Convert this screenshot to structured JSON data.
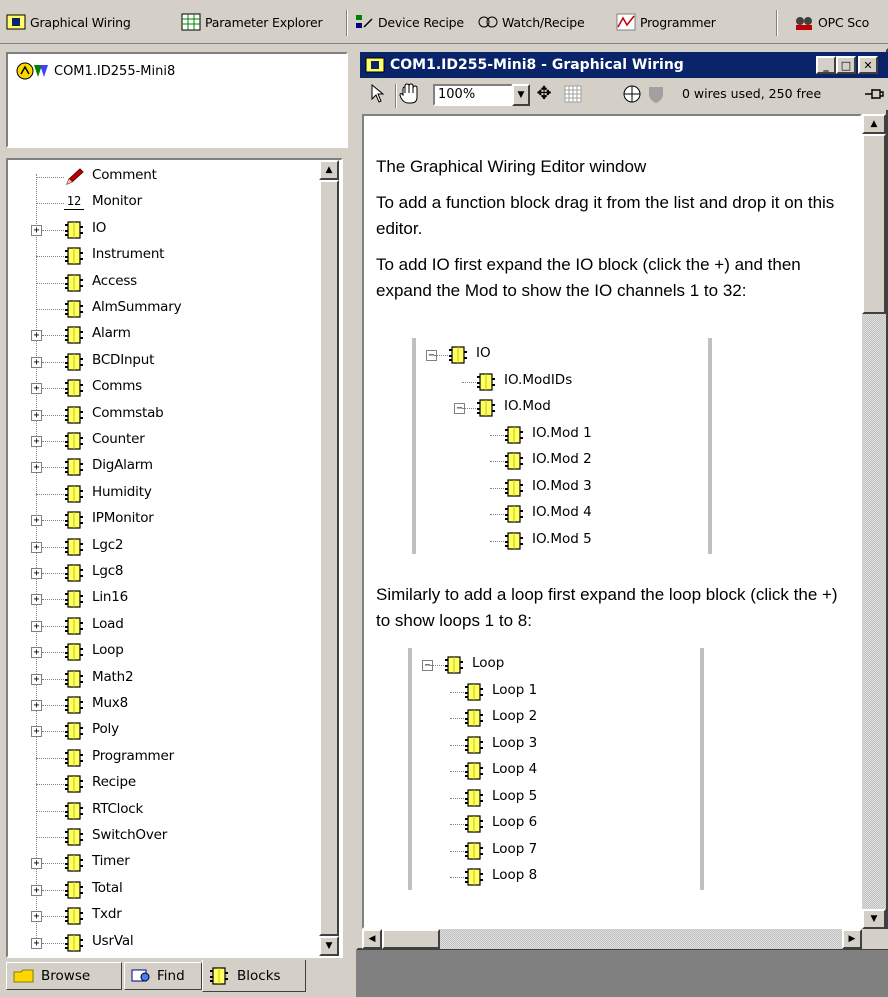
{
  "toolbar": {
    "items": [
      {
        "label": "Graphical Wiring",
        "accel": "G",
        "icon": "graphical-wiring-icon"
      },
      {
        "label": "Parameter Explorer",
        "accel": "",
        "icon": "parameter-explorer-icon"
      },
      {
        "label": "Device Recipe",
        "accel": "R",
        "icon": "device-recipe-icon"
      },
      {
        "label": "Watch/Recipe",
        "accel": "a",
        "icon": "watch-recipe-icon"
      },
      {
        "label": "Programmer",
        "accel": "P",
        "icon": "programmer-icon"
      },
      {
        "label": "OPC Sco",
        "accel": "C",
        "icon": "opc-scope-icon"
      }
    ]
  },
  "device": {
    "name": "COM1.ID255-Mini8"
  },
  "blocks": {
    "items": [
      {
        "label": "Comment",
        "expandable": false,
        "icon": "pencil-icon"
      },
      {
        "label": "Monitor",
        "expandable": false,
        "icon": "monitor-icon"
      },
      {
        "label": "IO",
        "expandable": true,
        "icon": "block-icon"
      },
      {
        "label": "Instrument",
        "expandable": false,
        "icon": "block-icon"
      },
      {
        "label": "Access",
        "expandable": false,
        "icon": "block-icon"
      },
      {
        "label": "AlmSummary",
        "expandable": false,
        "icon": "block-icon"
      },
      {
        "label": "Alarm",
        "expandable": true,
        "icon": "block-icon"
      },
      {
        "label": "BCDInput",
        "expandable": true,
        "icon": "block-icon"
      },
      {
        "label": "Comms",
        "expandable": true,
        "icon": "block-icon"
      },
      {
        "label": "Commstab",
        "expandable": true,
        "icon": "block-icon"
      },
      {
        "label": "Counter",
        "expandable": true,
        "icon": "block-icon"
      },
      {
        "label": "DigAlarm",
        "expandable": true,
        "icon": "block-icon"
      },
      {
        "label": "Humidity",
        "expandable": false,
        "icon": "block-icon"
      },
      {
        "label": "IPMonitor",
        "expandable": true,
        "icon": "block-icon"
      },
      {
        "label": "Lgc2",
        "expandable": true,
        "icon": "block-icon"
      },
      {
        "label": "Lgc8",
        "expandable": true,
        "icon": "block-icon"
      },
      {
        "label": "Lin16",
        "expandable": true,
        "icon": "block-icon"
      },
      {
        "label": "Load",
        "expandable": true,
        "icon": "block-icon"
      },
      {
        "label": "Loop",
        "expandable": true,
        "icon": "block-icon"
      },
      {
        "label": "Math2",
        "expandable": true,
        "icon": "block-icon"
      },
      {
        "label": "Mux8",
        "expandable": true,
        "icon": "block-icon"
      },
      {
        "label": "Poly",
        "expandable": true,
        "icon": "block-icon"
      },
      {
        "label": "Programmer",
        "expandable": false,
        "icon": "block-icon"
      },
      {
        "label": "Recipe",
        "expandable": false,
        "icon": "block-icon"
      },
      {
        "label": "RTClock",
        "expandable": false,
        "icon": "block-icon"
      },
      {
        "label": "SwitchOver",
        "expandable": false,
        "icon": "block-icon"
      },
      {
        "label": "Timer",
        "expandable": true,
        "icon": "block-icon"
      },
      {
        "label": "Total",
        "expandable": true,
        "icon": "block-icon"
      },
      {
        "label": "Txdr",
        "expandable": true,
        "icon": "block-icon"
      },
      {
        "label": "UsrVal",
        "expandable": true,
        "icon": "block-icon"
      }
    ]
  },
  "tabs": [
    {
      "label": "Browse",
      "icon": "folder-icon",
      "active": false
    },
    {
      "label": "Find",
      "icon": "find-icon",
      "active": false
    },
    {
      "label": "Blocks",
      "icon": "block-icon",
      "active": true
    }
  ],
  "window": {
    "title": "COM1.ID255-Mini8 - Graphical Wiring",
    "zoom": "100%",
    "wire_status": "0 wires used, 250 free"
  },
  "editor": {
    "paragraphs": [
      "The Graphical Wiring Editor window",
      "To add a function block drag it from the list and drop it on this editor.",
      "To add IO first expand the IO block (click the +) and then expand the Mod to show the IO channels 1 to 32:",
      "Similarly to add a loop first expand the loop block (click the +) to show loops 1 to 8:"
    ],
    "io_example": [
      "IO",
      "IO.ModIDs",
      "IO.Mod",
      "IO.Mod 1",
      "IO.Mod 2",
      "IO.Mod 3",
      "IO.Mod 4",
      "IO.Mod 5"
    ],
    "loop_example": [
      "Loop",
      "Loop 1",
      "Loop 2",
      "Loop 3",
      "Loop 4",
      "Loop 5",
      "Loop 6",
      "Loop 7",
      "Loop 8"
    ]
  },
  "colors": {
    "titlebar": "#0a246a",
    "chrome": "#d4d0c8",
    "block_icon": "#ffff66"
  }
}
